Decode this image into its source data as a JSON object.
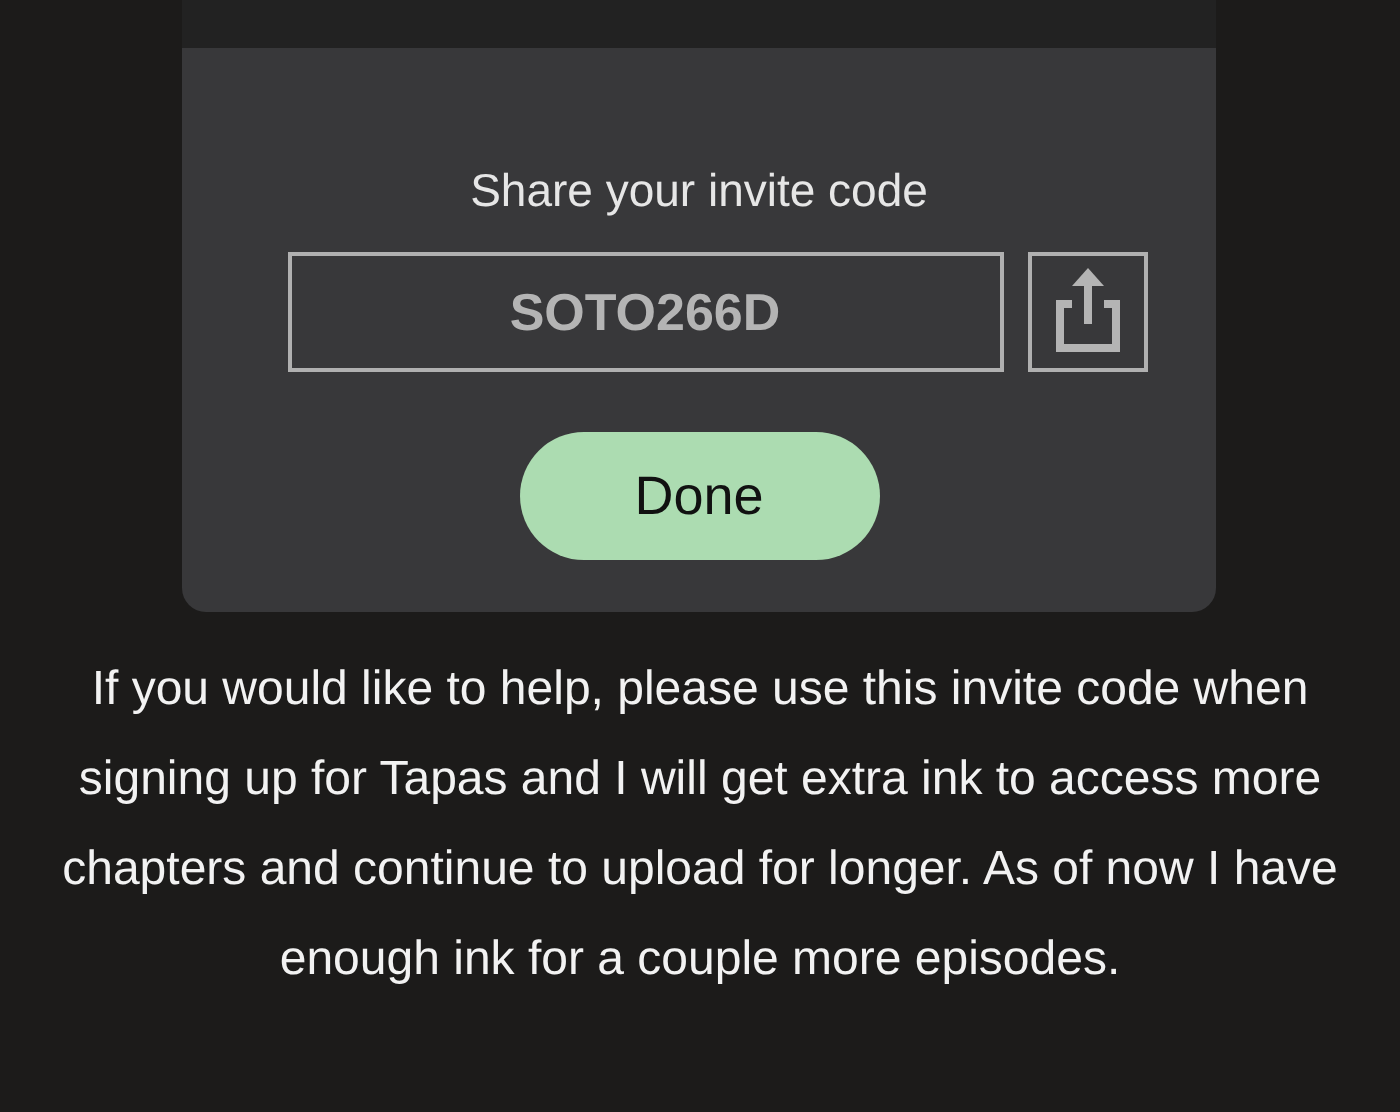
{
  "dialog": {
    "title": "Share your invite code",
    "code": "SOTO266D",
    "done_button": "Done"
  },
  "caption": "If you would like to help, please use this invite code when signing up for Tapas and I will get extra ink to access more chapters and continue to upload for longer. As of now I have enough ink for a couple more episodes."
}
